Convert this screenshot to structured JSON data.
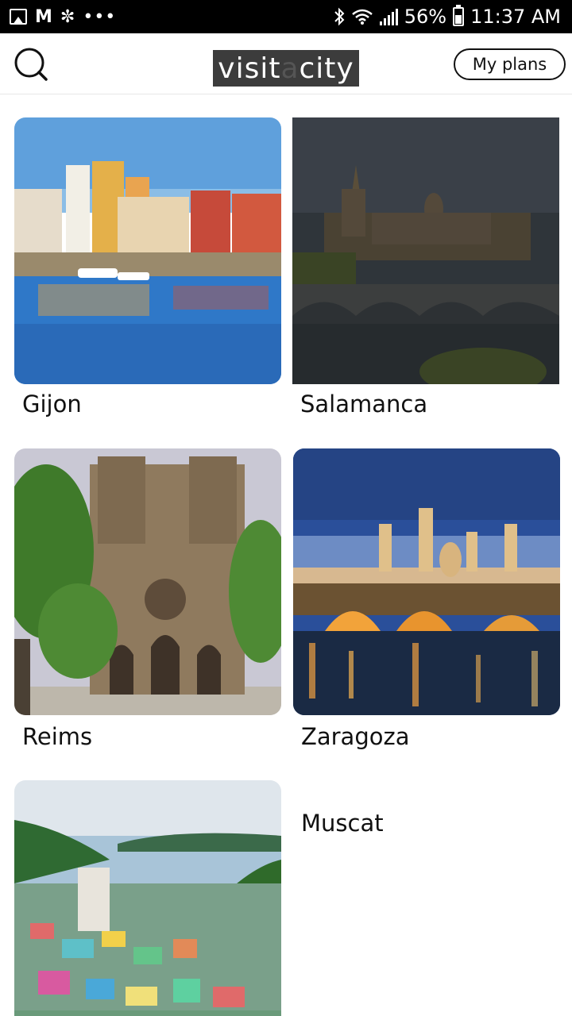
{
  "status_bar": {
    "battery": "56%",
    "time": "11:37 AM",
    "dots": "•••",
    "icons": [
      "gallery-icon",
      "gmail-icon",
      "fan-icon",
      "bluetooth-icon",
      "wifi-icon",
      "signal-icon",
      "battery-icon"
    ]
  },
  "header": {
    "logo_text_1": "visit",
    "logo_text_2": "a",
    "logo_text_3": "city",
    "my_plans_label": "My plans",
    "search_icon": "search-icon"
  },
  "cities": [
    {
      "name": "Gijon"
    },
    {
      "name": "Salamanca"
    },
    {
      "name": "Reims"
    },
    {
      "name": "Zaragoza"
    },
    {
      "name": "Muscat"
    },
    {
      "name": ""
    }
  ],
  "colors": {
    "status_bar_bg": "#000000",
    "logo_bg": "#3c3c3c",
    "text": "#111111"
  }
}
